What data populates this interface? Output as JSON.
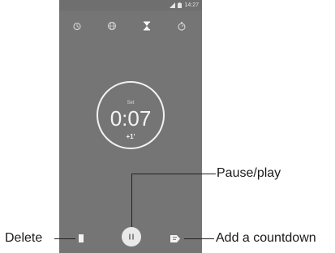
{
  "status_bar": {
    "time": "14:27"
  },
  "tabs": [
    {
      "name": "alarm-tab",
      "icon": "alarm-icon"
    },
    {
      "name": "world-clock-tab",
      "icon": "world-clock-icon"
    },
    {
      "name": "timer-tab",
      "icon": "hourglass-icon",
      "active": true
    },
    {
      "name": "stopwatch-tab",
      "icon": "stopwatch-icon"
    }
  ],
  "timer": {
    "label": "Set",
    "time": "0:07",
    "add_minute": "+1'"
  },
  "controls": {
    "delete": "delete-icon",
    "pause_play": "pause-icon",
    "add_countdown": "add-countdown-icon"
  },
  "callouts": {
    "pause_play": "Pause/play",
    "delete": "Delete",
    "add_countdown": "Add a countdown"
  },
  "colors": {
    "screen_bg": "#757575",
    "foreground": "#f4f4f4",
    "callout_text": "#1a1a1a"
  }
}
